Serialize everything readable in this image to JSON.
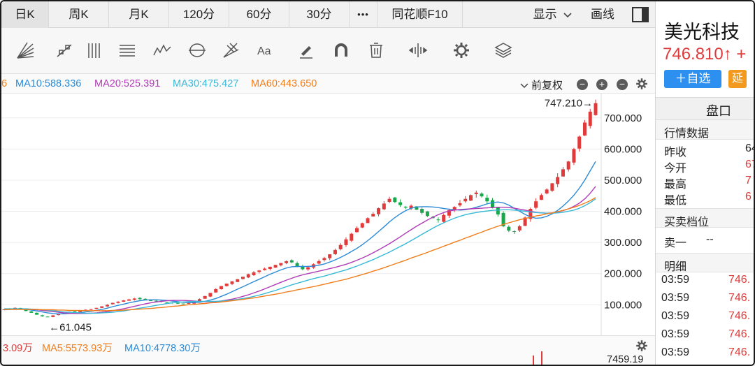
{
  "tabs": [
    {
      "label": "日K",
      "active": true
    },
    {
      "label": "周K"
    },
    {
      "label": "月K"
    },
    {
      "label": "120分"
    },
    {
      "label": "60分"
    },
    {
      "label": "30分"
    },
    {
      "label": "•••"
    },
    {
      "label": "同花顺F10"
    }
  ],
  "tabs_right": {
    "display": "显示",
    "draw": "画线"
  },
  "ma_legend": [
    {
      "label": "6",
      "color": "#f07d1a"
    },
    {
      "label": "MA10:588.336",
      "color": "#2b8bd6"
    },
    {
      "label": "MA20:525.391",
      "color": "#b03bb6"
    },
    {
      "label": "MA30:475.427",
      "color": "#37b9d6"
    },
    {
      "label": "MA60:443.650",
      "color": "#f07d1a"
    }
  ],
  "adjust": "前复权",
  "volume_legend": [
    {
      "label": "3.09万",
      "color": "#e03a3a"
    },
    {
      "label": "MA5:5573.93万",
      "color": "#f07d1a"
    },
    {
      "label": "MA10:4778.30万",
      "color": "#2b8bd6"
    }
  ],
  "volume_axis_label": "7459.19",
  "colors": {
    "up": "#e03a3a",
    "down": "#1aa64b",
    "accent": "#2d8ff0"
  },
  "chart_data": {
    "type": "line",
    "y_ticks": [
      "700.000",
      "600.000",
      "500.000",
      "400.000",
      "300.000",
      "200.000",
      "100.000"
    ],
    "y_tick_values": [
      700,
      600,
      500,
      400,
      300,
      200,
      100
    ],
    "ylim": [
      20,
      760
    ],
    "high_annotation": "747.210→",
    "low_annotation": "←61.045",
    "high_value": 747.21,
    "low_value": 61.045,
    "close_series": [
      85,
      88,
      90,
      86,
      80,
      74,
      68,
      63,
      62,
      66,
      70,
      75,
      78,
      76,
      80,
      84,
      86,
      90,
      95,
      100,
      106,
      110,
      114,
      117,
      120,
      118,
      116,
      114,
      112,
      110,
      108,
      106,
      104,
      103,
      105,
      110,
      118,
      128,
      138,
      150,
      160,
      168,
      175,
      182,
      190,
      198,
      204,
      210,
      216,
      222,
      228,
      234,
      240,
      236,
      224,
      214,
      220,
      230,
      240,
      250,
      262,
      276,
      292,
      310,
      328,
      346,
      362,
      378,
      392,
      410,
      425,
      440,
      430,
      420,
      412,
      418,
      405,
      395,
      385,
      378,
      372,
      388,
      404,
      414,
      426,
      440,
      452,
      460,
      448,
      432,
      412,
      390,
      352,
      338,
      336,
      352,
      380,
      408,
      432,
      452,
      470,
      490,
      510,
      535,
      560,
      600,
      640,
      685,
      720,
      747
    ],
    "series": [
      {
        "name": "MA10",
        "color": "#2b8bd6",
        "values": [
          84,
          85,
          86,
          86,
          85,
          83,
          80,
          77,
          74,
          72,
          71,
          71,
          72,
          73,
          75,
          77,
          79,
          82,
          85,
          89,
          94,
          98,
          102,
          106,
          110,
          113,
          115,
          116,
          116,
          115,
          114,
          112,
          110,
          108,
          107,
          107,
          108,
          111,
          115,
          120,
          127,
          134,
          142,
          150,
          158,
          166,
          174,
          182,
          190,
          198,
          205,
          212,
          218,
          222,
          223,
          223,
          223,
          224,
          227,
          231,
          237,
          244,
          252,
          261,
          271,
          281,
          293,
          306,
          320,
          335,
          350,
          366,
          380,
          392,
          402,
          410,
          414,
          415,
          415,
          414,
          412,
          409,
          407,
          405,
          404,
          405,
          408,
          413,
          418,
          424,
          428,
          430,
          427,
          420,
          410,
          400,
          390,
          382,
          378,
          379,
          384,
          392,
          403,
          417,
          433,
          452,
          474,
          500,
          530,
          560
        ]
      },
      {
        "name": "MA20",
        "color": "#b03bb6",
        "values": [
          86,
          86,
          86,
          86,
          86,
          85,
          84,
          82,
          80,
          78,
          76,
          74,
          73,
          72,
          72,
          72,
          73,
          74,
          76,
          78,
          81,
          84,
          87,
          91,
          95,
          99,
          103,
          106,
          109,
          111,
          113,
          114,
          114,
          114,
          113,
          112,
          111,
          110,
          110,
          110,
          112,
          115,
          118,
          122,
          127,
          132,
          138,
          144,
          151,
          158,
          165,
          172,
          179,
          185,
          191,
          196,
          200,
          204,
          208,
          212,
          216,
          220,
          225,
          230,
          236,
          243,
          250,
          258,
          267,
          276,
          286,
          296,
          307,
          318,
          330,
          341,
          352,
          362,
          372,
          381,
          389,
          396,
          401,
          404,
          406,
          407,
          408,
          409,
          410,
          411,
          412,
          413,
          413,
          412,
          410,
          407,
          404,
          400,
          397,
          395,
          394,
          395,
          398,
          402,
          408,
          416,
          426,
          440,
          458,
          480
        ]
      },
      {
        "name": "MA30",
        "color": "#37b9d6",
        "values": [
          87,
          87,
          87,
          87,
          87,
          86,
          85,
          84,
          83,
          81,
          79,
          77,
          76,
          75,
          74,
          73,
          73,
          73,
          74,
          75,
          76,
          78,
          80,
          83,
          86,
          89,
          92,
          95,
          98,
          101,
          104,
          106,
          108,
          109,
          110,
          111,
          111,
          111,
          111,
          111,
          112,
          113,
          115,
          117,
          120,
          123,
          127,
          131,
          136,
          141,
          146,
          152,
          158,
          164,
          169,
          174,
          179,
          184,
          188,
          192,
          197,
          202,
          207,
          212,
          218,
          224,
          231,
          238,
          245,
          253,
          261,
          269,
          278,
          287,
          296,
          306,
          316,
          326,
          336,
          346,
          355,
          363,
          371,
          378,
          384,
          389,
          393,
          396,
          399,
          401,
          403,
          404,
          405,
          405,
          404,
          402,
          400,
          398,
          396,
          395,
          394,
          394,
          395,
          397,
          400,
          404,
          410,
          418,
          428,
          440
        ]
      },
      {
        "name": "MA60",
        "color": "#f07d1a",
        "values": [
          85,
          85,
          85,
          85,
          85,
          85,
          85,
          84,
          84,
          84,
          83,
          83,
          82,
          82,
          82,
          81,
          81,
          81,
          81,
          81,
          82,
          82,
          83,
          84,
          85,
          86,
          87,
          88,
          90,
          91,
          93,
          95,
          96,
          98,
          100,
          101,
          103,
          104,
          106,
          107,
          109,
          111,
          113,
          115,
          117,
          120,
          122,
          125,
          128,
          131,
          134,
          137,
          141,
          144,
          148,
          151,
          155,
          158,
          162,
          166,
          170,
          174,
          178,
          182,
          187,
          192,
          197,
          202,
          208,
          213,
          219,
          225,
          231,
          237,
          243,
          250,
          256,
          262,
          268,
          275,
          281,
          288,
          294,
          301,
          307,
          314,
          320,
          327,
          333,
          340,
          346,
          352,
          358,
          363,
          368,
          373,
          377,
          381,
          385,
          388,
          392,
          395,
          399,
          403,
          408,
          413,
          419,
          426,
          434,
          444
        ]
      }
    ]
  }
}
